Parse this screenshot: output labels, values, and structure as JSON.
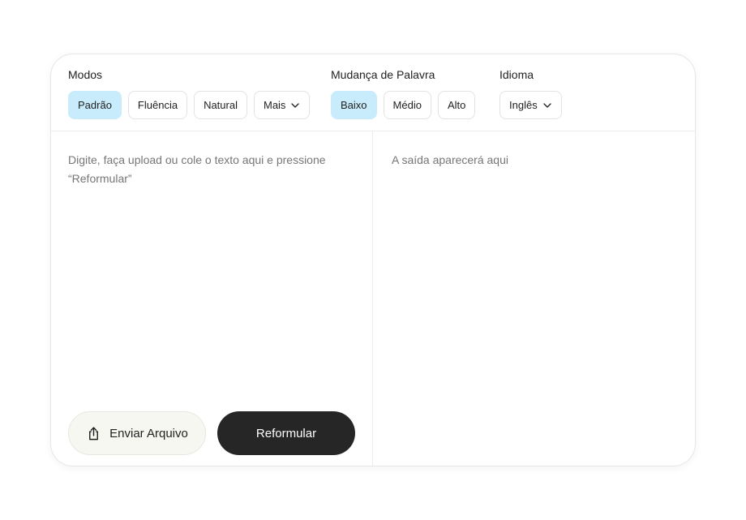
{
  "modes": {
    "title": "Modos",
    "options": [
      "Padrão",
      "Fluência",
      "Natural"
    ],
    "more_label": "Mais",
    "selected": "Padrão"
  },
  "word_change": {
    "title": "Mudança de Palavra",
    "options": [
      "Baixo",
      "Médio",
      "Alto"
    ],
    "selected": "Baixo"
  },
  "language": {
    "title": "Idioma",
    "value": "Inglês"
  },
  "input": {
    "placeholder": "Digite, faça upload ou cole o texto aqui e pressione “Reformular”"
  },
  "output": {
    "placeholder": "A saída aparecerá aqui"
  },
  "actions": {
    "upload_label": "Enviar Arquivo",
    "submit_label": "Reformular"
  },
  "colors": {
    "active_chip": "#c9ecfc",
    "primary_button": "#262626",
    "secondary_button": "#f7f7f2"
  },
  "icons": {
    "upload": "share-upload-icon",
    "dropdown": "chevron-down-icon"
  }
}
